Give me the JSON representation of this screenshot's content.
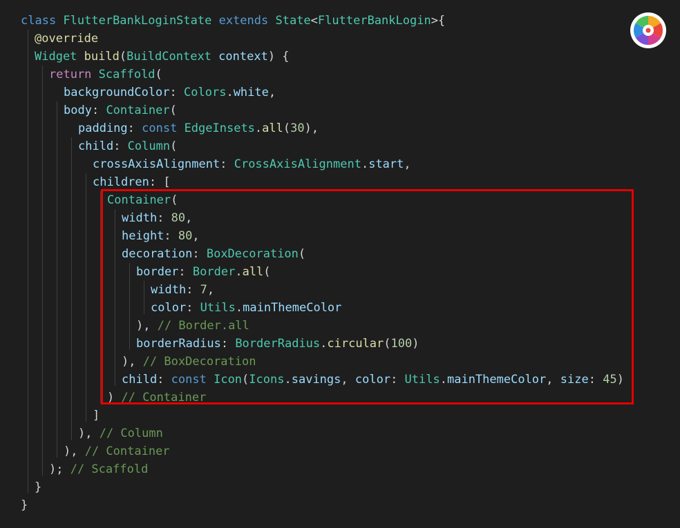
{
  "colors": {
    "background": "#1e1e1e",
    "highlight_border": "#e60000",
    "keyword": "#569cd6",
    "control": "#c586c0",
    "type": "#4ec9b0",
    "function": "#dcdcaa",
    "property": "#9cdcfe",
    "number": "#b5cea8",
    "comment": "#6a9955",
    "punct": "#d4d4d4",
    "bracket": "#ffd700"
  },
  "icons": {
    "app_logo": "color-wheel-logo-icon"
  },
  "code_lines": [
    [
      [
        "keyword",
        "class "
      ],
      [
        "type",
        "FlutterBankLoginState "
      ],
      [
        "keyword",
        "extends "
      ],
      [
        "type",
        "State"
      ],
      [
        "punct",
        "<"
      ],
      [
        "type",
        "FlutterBankLogin"
      ],
      [
        "punct",
        ">{"
      ]
    ],
    [
      [
        "function",
        "@override"
      ]
    ],
    [
      [
        "type",
        "Widget "
      ],
      [
        "function",
        "build"
      ],
      [
        "punct",
        "("
      ],
      [
        "type",
        "BuildContext "
      ],
      [
        "property",
        "context"
      ],
      [
        "punct",
        ") {"
      ]
    ],
    [
      [
        "control",
        "return "
      ],
      [
        "type",
        "Scaffold"
      ],
      [
        "punct",
        "("
      ]
    ],
    [
      [
        "property",
        "backgroundColor"
      ],
      [
        "punct",
        ": "
      ],
      [
        "type",
        "Colors"
      ],
      [
        "punct",
        "."
      ],
      [
        "property",
        "white"
      ],
      [
        "punct",
        ","
      ]
    ],
    [
      [
        "property",
        "body"
      ],
      [
        "punct",
        ": "
      ],
      [
        "type",
        "Container"
      ],
      [
        "punct",
        "("
      ]
    ],
    [
      [
        "property",
        "padding"
      ],
      [
        "punct",
        ": "
      ],
      [
        "keyword",
        "const "
      ],
      [
        "type",
        "EdgeInsets"
      ],
      [
        "punct",
        "."
      ],
      [
        "function",
        "all"
      ],
      [
        "punct",
        "("
      ],
      [
        "number",
        "30"
      ],
      [
        "punct",
        "),"
      ]
    ],
    [
      [
        "property",
        "child"
      ],
      [
        "punct",
        ": "
      ],
      [
        "type",
        "Column"
      ],
      [
        "punct",
        "("
      ]
    ],
    [
      [
        "property",
        "crossAxisAlignment"
      ],
      [
        "punct",
        ": "
      ],
      [
        "type",
        "CrossAxisAlignment"
      ],
      [
        "punct",
        "."
      ],
      [
        "property",
        "start"
      ],
      [
        "punct",
        ","
      ]
    ],
    [
      [
        "property",
        "children"
      ],
      [
        "punct",
        ": ["
      ]
    ],
    [
      [
        "type",
        "Container"
      ],
      [
        "punct",
        "("
      ]
    ],
    [
      [
        "property",
        "width"
      ],
      [
        "punct",
        ": "
      ],
      [
        "number",
        "80"
      ],
      [
        "punct",
        ","
      ]
    ],
    [
      [
        "property",
        "height"
      ],
      [
        "punct",
        ": "
      ],
      [
        "number",
        "80"
      ],
      [
        "punct",
        ","
      ]
    ],
    [
      [
        "property",
        "decoration"
      ],
      [
        "punct",
        ": "
      ],
      [
        "type",
        "BoxDecoration"
      ],
      [
        "punct",
        "("
      ]
    ],
    [
      [
        "property",
        "border"
      ],
      [
        "punct",
        ": "
      ],
      [
        "type",
        "Border"
      ],
      [
        "punct",
        "."
      ],
      [
        "function",
        "all"
      ],
      [
        "punct",
        "("
      ]
    ],
    [
      [
        "property",
        "width"
      ],
      [
        "punct",
        ": "
      ],
      [
        "number",
        "7"
      ],
      [
        "punct",
        ","
      ]
    ],
    [
      [
        "property",
        "color"
      ],
      [
        "punct",
        ": "
      ],
      [
        "type",
        "Utils"
      ],
      [
        "punct",
        "."
      ],
      [
        "property",
        "mainThemeColor"
      ]
    ],
    [
      [
        "punct",
        "), "
      ],
      [
        "comment",
        "// Border.all"
      ]
    ],
    [
      [
        "property",
        "borderRadius"
      ],
      [
        "punct",
        ": "
      ],
      [
        "type",
        "BorderRadius"
      ],
      [
        "punct",
        "."
      ],
      [
        "function",
        "circular"
      ],
      [
        "punct",
        "("
      ],
      [
        "number",
        "100"
      ],
      [
        "punct",
        ")"
      ]
    ],
    [
      [
        "punct",
        "), "
      ],
      [
        "comment",
        "// BoxDecoration"
      ]
    ],
    [
      [
        "property",
        "child"
      ],
      [
        "punct",
        ": "
      ],
      [
        "keyword",
        "const "
      ],
      [
        "type",
        "Icon"
      ],
      [
        "punct",
        "("
      ],
      [
        "type",
        "Icons"
      ],
      [
        "punct",
        "."
      ],
      [
        "property",
        "savings"
      ],
      [
        "punct",
        ", "
      ],
      [
        "property",
        "color"
      ],
      [
        "punct",
        ": "
      ],
      [
        "type",
        "Utils"
      ],
      [
        "punct",
        "."
      ],
      [
        "property",
        "mainThemeColor"
      ],
      [
        "punct",
        ", "
      ],
      [
        "property",
        "size"
      ],
      [
        "punct",
        ": "
      ],
      [
        "number",
        "45"
      ],
      [
        "punct",
        ")"
      ]
    ],
    [
      [
        "punct",
        ") "
      ],
      [
        "comment",
        "// Container"
      ]
    ],
    [
      [
        "punct",
        "]"
      ]
    ],
    [
      [
        "punct",
        "), "
      ],
      [
        "comment",
        "// Column"
      ]
    ],
    [
      [
        "punct",
        "), "
      ],
      [
        "comment",
        "// Container"
      ]
    ],
    [
      [
        "punct",
        "); "
      ],
      [
        "comment",
        "// Scaffold"
      ]
    ],
    [
      [
        "punct",
        "}"
      ]
    ],
    [
      [
        "punct",
        "}"
      ]
    ]
  ]
}
